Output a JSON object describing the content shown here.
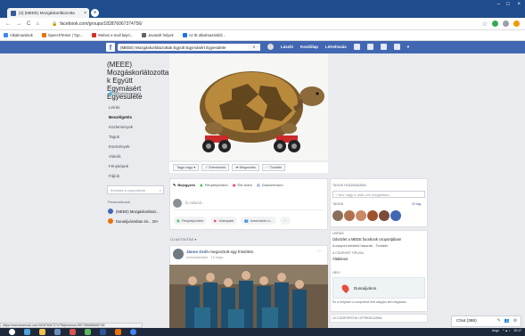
{
  "browser": {
    "tab_title": "(2) (MEEE) Mozgáskorlátozotta",
    "url": "facebook.com/groups/182876067374756/",
    "bookmarks": [
      {
        "label": "Alkalmazások",
        "color": "#4285f4"
      },
      {
        "label": "SpeechTester | Typ...",
        "color": "#e8710a"
      },
      {
        "label": "Webes e-mail bejel...",
        "color": "#d93025"
      },
      {
        "label": "Javasolt helyek",
        "color": "#5f6368"
      },
      {
        "label": "Az IE alkalmazásból...",
        "color": "#1a73e8"
      }
    ],
    "status_url": "https://www.facebook.com/182876067374756/photos/a.2907386668368745/"
  },
  "fb_header": {
    "search_value": "(MEEE) Mozgáskorlátozottak Együtt Egymásért Egyesülete",
    "user_name": "László",
    "nav": [
      "Kezdőlap",
      "Létrehozás"
    ]
  },
  "group": {
    "name": "(MEEE) Mozgáskorlátozotta k Együtt Egymásért Egyesülete",
    "type": "Nyilvános csoport",
    "nav": [
      "Leírás",
      "Beszélgetés",
      "Közlemények",
      "Tagok",
      "Események",
      "Videók",
      "Fényképek",
      "Fájlok"
    ],
    "active_nav": "Beszélgetés",
    "search_placeholder": "Keresés a csoportban",
    "shortcuts_title": "Parancsikonok",
    "shortcuts": [
      "(MEEE) Mozgáskorlátoz...",
      "Dunaújvárosban és... 20+"
    ]
  },
  "cover_buttons": [
    "Tagja vagy ▾",
    "✓ Értesítések",
    "➦ Megosztás",
    "··· További"
  ],
  "composer": {
    "tabs": [
      "Bejegyzés",
      "Fénykép/videó",
      "Élő videó",
      "Dokumentum"
    ],
    "placeholder": "Írj valamit...",
    "pills": [
      "Fénykép/videó",
      "Videopárti",
      "Ismerősök m...",
      "···"
    ]
  },
  "feed": {
    "header": "ÚJ AKTIVITÁS ▾",
    "post_author": "János Gróh",
    "post_action": "megosztott egy frissítést.",
    "post_meta": "Adminisztrátor · 15 órája"
  },
  "right": {
    "add_members_title": "TAGOK HOZZÁADÁSA",
    "invite_placeholder": "+ Név vagy e-mail-cím megadása...",
    "members_title": "TAGOK",
    "members_count": "20 tag",
    "about_title": "LEÍRÁS",
    "about_text": "Üdvözlet a MEEE facebook csoportjában!",
    "about_more": "A csoport remekül használ... További",
    "group_type_title": "A CSOPORT TÍPUSA",
    "group_type": "Általános",
    "location_title": "HELY",
    "location": "Dunaújváros",
    "location_note": "Ez a helyszín a csoportod leírt alapján lett megadva.",
    "recent_title": "ÚJ CSOPORTOK LÉTREHOZÁSA"
  },
  "chat": {
    "label": "Chat (388)"
  },
  "taskbar": {
    "lang": "Ango",
    "time": "20:17"
  }
}
